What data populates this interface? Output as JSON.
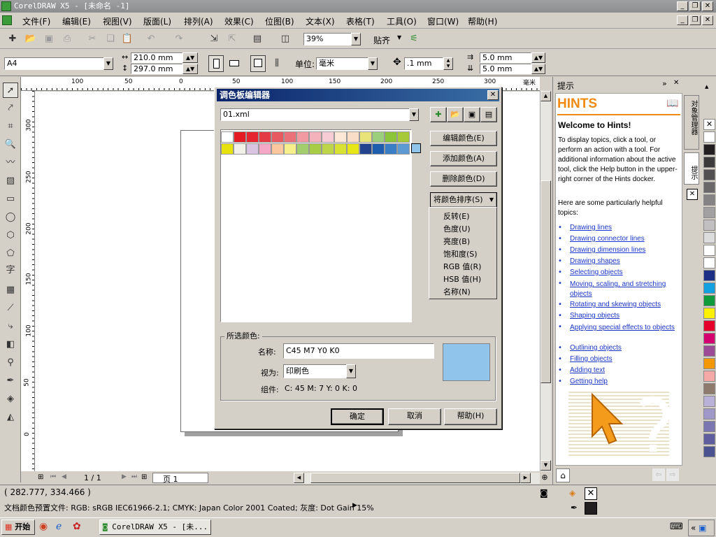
{
  "window": {
    "title": "CorelDRAW X5 - [未命名 -1]"
  },
  "menu": [
    {
      "label": "文件(F)"
    },
    {
      "label": "编辑(E)"
    },
    {
      "label": "视图(V)"
    },
    {
      "label": "版面(L)"
    },
    {
      "label": "排列(A)"
    },
    {
      "label": "效果(C)"
    },
    {
      "label": "位图(B)"
    },
    {
      "label": "文本(X)"
    },
    {
      "label": "表格(T)"
    },
    {
      "label": "工具(O)"
    },
    {
      "label": "窗口(W)"
    },
    {
      "label": "帮助(H)"
    }
  ],
  "toolbar": {
    "zoom": "39%",
    "snap_label": "贴齐"
  },
  "property_bar": {
    "page_size": "A4",
    "width": "210.0 mm",
    "height": "297.0 mm",
    "unit_label": "单位:",
    "unit": "毫米",
    "nudge": ".1 mm",
    "dup_x": "5.0 mm",
    "dup_y": "5.0 mm"
  },
  "ruler": {
    "h_labels": [
      "100",
      "50",
      "0",
      "50",
      "100",
      "150",
      "200",
      "250",
      "300"
    ],
    "h_unit": "毫米",
    "v_labels": [
      "300",
      "250",
      "200",
      "150",
      "100",
      "50",
      "0"
    ]
  },
  "page_nav": {
    "counter": "1 / 1",
    "tab": "页 1"
  },
  "status": {
    "coords": "( 282.777, 334.466 )",
    "color_profile": "文档颜色预置文件: RGB: sRGB IEC61966-2.1; CMYK: Japan Color 2001 Coated; 灰度: Dot Gain 15%"
  },
  "taskbar": {
    "start": "开始",
    "app": "CorelDRAW X5 - [未..."
  },
  "hints": {
    "panel_title": "提示",
    "logo": "HINTS",
    "heading": "Welcome to Hints!",
    "para1": "To display topics, click a tool, or perform an action with a tool. For additional information about the active tool, click the Help button in the upper-right corner of the Hints docker.",
    "para2": "Here are some particularly helpful topics:",
    "links": [
      "Drawing lines",
      "Drawing connector lines",
      "Drawing dimension lines",
      "Drawing shapes",
      "Selecting objects",
      "Moving, scaling, and stretching objects",
      "Rotating and skewing objects",
      "Shaping objects",
      "Applying special effects to objects",
      "Outlining objects",
      "Filling objects",
      "Adding text",
      "Getting help"
    ],
    "side_tab1": "对象管理器",
    "side_tab2": "提示"
  },
  "dialog": {
    "title": "调色板编辑器",
    "file": "01.xml",
    "edit_color": "编辑颜色(E)",
    "add_color": "添加颜色(A)",
    "delete_color": "删除颜色(D)",
    "sort": "将颜色排序(S)",
    "sort_menu": [
      "反转(E)",
      "色度(U)",
      "亮度(B)",
      "饱和度(S)",
      "RGB 值(R)",
      "HSB 值(H)",
      "名称(N)"
    ],
    "group_label": "所选颜色:",
    "name_label": "名称:",
    "name_value": "C45 M7 Y0 K0",
    "view_label": "视为:",
    "view_value": "印刷色",
    "component_label": "组件:",
    "component_value": "C: 45 M: 7 Y: 0 K: 0",
    "ok": "确定",
    "cancel": "取消",
    "help": "帮助(H)",
    "selected_color": "#90c4ea",
    "swatches_row1": [
      "#ffffff",
      "#e41b23",
      "#e52630",
      "#e43a44",
      "#e75a5f",
      "#ea7177",
      "#f29aa2",
      "#f4b3bc",
      "#f8ccd4",
      "#fde8d8",
      "#f9ddc6",
      "#e8e47a",
      "#9bcf7c",
      "#8cc43a",
      "#a6c93a"
    ],
    "swatches_row2": [
      "#e8e20c",
      "#f1f1ea",
      "#d9c5e2",
      "#f4a8c6",
      "#fbc79e",
      "#f6ef8c",
      "#a2ce6e",
      "#a8cc46",
      "#bed54a",
      "#d7e232",
      "#e7e617",
      "#23438f",
      "#1f5dae",
      "#3a7fc6",
      "#5d9ad3"
    ]
  },
  "palette_colors": [
    "#ffffff",
    "#231f20",
    "#3d3b3c",
    "#535051",
    "#6b6869",
    "#858283",
    "#a3a0a1",
    "#c1bfc0",
    "#dddcdc",
    "#ffffff",
    "#ffffff",
    "#1d2f85",
    "#13a0e0",
    "#0f9a3c",
    "#fff100",
    "#e4002b",
    "#d40070",
    "#9d4a96",
    "#f39800",
    "#f5a9a6",
    "#8f7b6d",
    "#b9b1d7",
    "#9f98c9",
    "#7b76b1",
    "#5f5d9e",
    "#4a5290"
  ]
}
